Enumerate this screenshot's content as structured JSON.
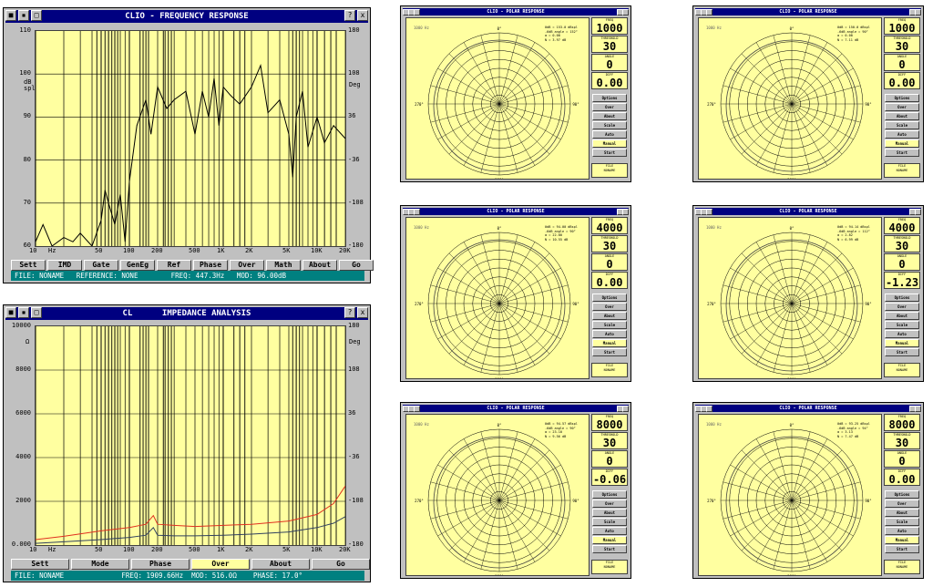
{
  "freq_window": {
    "title": "CLIO - FREQUENCY RESPONSE",
    "y_left_label": "dB\nspl",
    "y_right_label": "Deg",
    "y_left_ticks": [
      "110",
      "100",
      "90",
      "80",
      "70",
      "60"
    ],
    "y_right_ticks": [
      "180",
      "108",
      "36",
      "-36",
      "-108",
      "-180"
    ],
    "x_ticks": [
      "10",
      "Hz",
      "50",
      "100",
      "200",
      "500",
      "1K",
      "2K",
      "5K",
      "10K",
      "20K"
    ],
    "buttons": [
      "Sett",
      "IMD",
      "Gate",
      "GenEg",
      "Ref",
      "Phase",
      "Over",
      "Math",
      "About",
      "Go"
    ],
    "status": "FILE: NONAME   REFERENCE: NONE        FREQ: 447.3Hz   MOD: 96.00dB",
    "close_icons": [
      "?",
      "x"
    ]
  },
  "imp_window": {
    "title": "CL      IMPEDANCE ANALYSIS",
    "y_left_label": "Ω",
    "y_right_label": "Deg",
    "y_left_ticks": [
      "10000",
      "8000",
      "6000",
      "4000",
      "2000",
      "0.000"
    ],
    "y_right_ticks": [
      "180",
      "108",
      "36",
      "-36",
      "-108",
      "-180"
    ],
    "x_ticks": [
      "10",
      "Hz",
      "50",
      "100",
      "200",
      "500",
      "1K",
      "2K",
      "5K",
      "10K",
      "20K"
    ],
    "buttons": [
      "Sett",
      "Mode",
      "Phase",
      "Over",
      "About",
      "Go"
    ],
    "selected_button": "Over",
    "status": "FILE: NONAME              FREQ: 1909.66Hz  MOD: 516.0Ω    PHASE: 17.0°",
    "close_icons": [
      "?",
      "x"
    ]
  },
  "polar_common": {
    "title": "CLIO - POLAR RESPONSE",
    "caps": [
      "FREQ",
      "THRESHOLD",
      "ANGLE",
      "DIFF"
    ],
    "buttons": [
      "Options",
      "Over",
      "About",
      "Scale",
      "Auto",
      "Manual",
      "Start"
    ],
    "selected_button": "Manual",
    "file_label": "FILE",
    "file_value": "NONAME",
    "angle_labels": [
      "0°",
      "90°",
      "180°",
      "270°"
    ],
    "tag": "1000 Hz"
  },
  "polar_windows": [
    {
      "freq": "1000",
      "thr": "30",
      "angle": "0",
      "diff": "0.00",
      "info": "0dB = 153.0 dBspl\n-6dB angle = 152°\nα = 0.00\nN = 3.97 dB"
    },
    {
      "freq": "1000",
      "thr": "30",
      "angle": "0",
      "diff": "0.00",
      "info": "0dB = 150.0 dBspl\n-6dB angle = 90°\nα = 0.00\nN = 7.11 dB"
    },
    {
      "freq": "4000",
      "thr": "30",
      "angle": "0",
      "diff": "0.00",
      "info": "0dB = 94.00 dBspl\n-6dB angle = 90°\nα = 22.00\nN = 10.55 dB"
    },
    {
      "freq": "4000",
      "thr": "30",
      "angle": "0",
      "diff": "-1.23",
      "info": "0dB = 94.14 dBspl\n-6dB angle = 112°\nα = 2.82\nN = 6.99 dB"
    },
    {
      "freq": "8000",
      "thr": "30",
      "angle": "0",
      "diff": "-0.06",
      "info": "0dB = 94.57 dBspl\n-6dB angle = 90°\nα = 23.10\nN = 9.56 dB"
    },
    {
      "freq": "8000",
      "thr": "30",
      "angle": "0",
      "diff": "0.00",
      "info": "0dB = 93.25 dBspl\n-6dB angle = 94°\nα = 3.13\nN = 7.47 dB"
    }
  ],
  "chart_data": [
    {
      "type": "line",
      "title": "CLIO - FREQUENCY RESPONSE",
      "xlabel": "Hz",
      "ylabel": "dB spl",
      "x_scale": "log",
      "xlim": [
        10,
        20000
      ],
      "ylim": [
        60,
        110
      ],
      "series": [
        {
          "x": [
            10,
            12,
            15,
            20,
            25,
            30,
            40,
            50,
            55,
            60,
            70,
            80,
            90,
            100,
            120,
            150,
            170,
            200,
            250,
            300,
            400,
            500,
            600,
            700,
            800,
            900,
            1000,
            1200,
            1500,
            2000,
            2500,
            3000,
            4000,
            5000,
            5500,
            6000,
            7000,
            8000,
            10000,
            12000,
            15000,
            20000
          ],
          "y": [
            61,
            65,
            60,
            62,
            61,
            63,
            60,
            66,
            73,
            70,
            65,
            72,
            61,
            75,
            88,
            94,
            86,
            97,
            92,
            94,
            96,
            86,
            96,
            90,
            99,
            88,
            97,
            95,
            93,
            97,
            102,
            91,
            94,
            86,
            76,
            90,
            96,
            83,
            90,
            84,
            88,
            85
          ]
        }
      ]
    },
    {
      "type": "line",
      "title": "IMPEDANCE ANALYSIS",
      "xlabel": "Hz",
      "ylabel": "Ω",
      "x_scale": "log",
      "xlim": [
        10,
        20000
      ],
      "ylim": [
        0,
        10000
      ],
      "series": [
        {
          "color": "#e03020",
          "x": [
            10,
            20,
            50,
            100,
            150,
            180,
            200,
            300,
            500,
            1000,
            2000,
            5000,
            10000,
            15000,
            20000
          ],
          "y": [
            250,
            400,
            650,
            800,
            950,
            1350,
            950,
            900,
            850,
            900,
            950,
            1100,
            1400,
            1900,
            2700
          ]
        },
        {
          "color": "#304060",
          "x": [
            10,
            20,
            50,
            100,
            150,
            180,
            200,
            300,
            500,
            1000,
            2000,
            5000,
            10000,
            15000,
            20000
          ],
          "y": [
            80,
            150,
            250,
            350,
            450,
            800,
            450,
            420,
            420,
            450,
            500,
            600,
            800,
            1000,
            1300
          ]
        }
      ]
    }
  ]
}
